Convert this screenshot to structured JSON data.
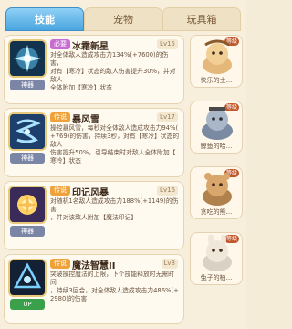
{
  "tabs": [
    {
      "label": "技能",
      "active": true
    },
    {
      "label": "宠物",
      "active": false
    },
    {
      "label": "玩具箱",
      "active": false
    }
  ],
  "skills": [
    {
      "badge": "必要",
      "badge_color": "#c96bd2",
      "name": "冰霜新星",
      "level": "Lv15",
      "level_tag": "神器",
      "icon_name": "ice-star-icon",
      "desc_lines": [
        "对全体敌人造成攻击力134%(+7600)的伤害，",
        "对有【寒冷】状态的敌人伤害提升30%，并对敌人",
        "全体附加【寒冷】状态"
      ]
    },
    {
      "badge": "传说",
      "badge_color": "#f0a23a",
      "name": "暴风雪",
      "level": "Lv17",
      "level_tag": "神器",
      "icon_name": "blizzard-icon",
      "desc_lines": [
        "操控暴风雪，每秒对全体敌人造成攻击力94%(",
        "+769)的伤害，持续3秒，对有【寒冷】状态的敌人",
        "伤害提升50%，引导结束时对敌人全体附加【",
        "寒冷】状态"
      ]
    },
    {
      "badge": "传说",
      "badge_color": "#f0a23a",
      "name": "印记风暴",
      "level": "Lv16",
      "level_tag": "神器",
      "icon_name": "mark-storm-icon",
      "desc_lines": [
        "对随机1名敌人造成攻击力188%(+1149)的伤害",
        "，并对该敌人附加【魔法印记】"
      ]
    },
    {
      "badge": "传说",
      "badge_color": "#f0a23a",
      "name": "魔法智慧II",
      "level": "Lv8",
      "level_tag": "UP",
      "icon_name": "magic-wisdom-icon",
      "desc_lines": [
        "突破操控魔法的上限，下个技能释放时无需时间",
        "，持续3回合，对全体敌人造成攻击力486%(+",
        "2980)的伤害"
      ]
    }
  ],
  "characters": [
    {
      "name": "快乐的土...",
      "badge": "等级"
    },
    {
      "name": "鲸鱼的哈...",
      "badge": "等级"
    },
    {
      "name": "贪吃的熊...",
      "badge": "等级"
    },
    {
      "name": "兔子的柏...",
      "badge": "等级"
    }
  ]
}
